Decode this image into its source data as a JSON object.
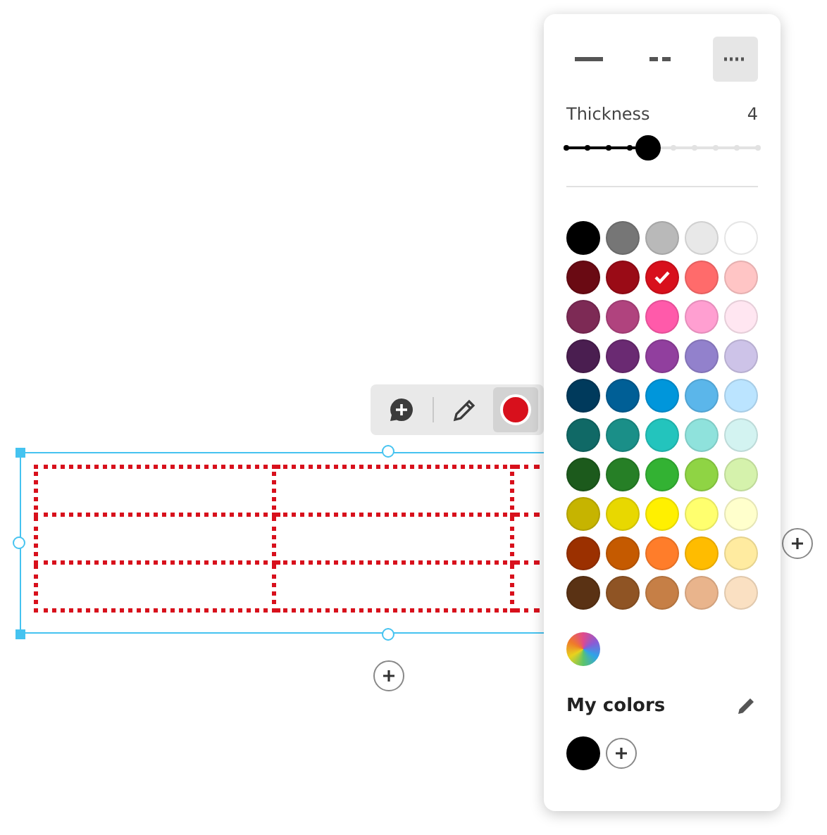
{
  "canvas": {
    "toolbar": [
      {
        "kind": "comment"
      },
      {
        "kind": "pen"
      },
      {
        "kind": "color",
        "selected": true
      }
    ]
  },
  "panel": {
    "line_styles": [
      {
        "kind": "solid",
        "selected": false
      },
      {
        "kind": "dashed",
        "selected": false
      },
      {
        "kind": "dotted",
        "selected": true
      }
    ],
    "thickness": {
      "label": "Thickness",
      "value": "4",
      "level": 0.43
    },
    "swatches": [
      {
        "color": "#000000",
        "selected": false
      },
      {
        "color": "#767676",
        "selected": false
      },
      {
        "color": "#b9b9b9",
        "selected": false
      },
      {
        "color": "#e8e8e8",
        "selected": false
      },
      {
        "color": "#ffffff",
        "selected": false
      },
      {
        "color": "#6a0a13",
        "selected": false
      },
      {
        "color": "#9a0b16",
        "selected": false
      },
      {
        "color": "#d8101c",
        "selected": true
      },
      {
        "color": "#ff6b6b",
        "selected": false
      },
      {
        "color": "#ffc5c5",
        "selected": false
      },
      {
        "color": "#7d2a55",
        "selected": false
      },
      {
        "color": "#b0437e",
        "selected": false
      },
      {
        "color": "#ff5aaa",
        "selected": false
      },
      {
        "color": "#ff9fd1",
        "selected": false
      },
      {
        "color": "#ffe6f1",
        "selected": false
      },
      {
        "color": "#4a1e50",
        "selected": false
      },
      {
        "color": "#6a2a72",
        "selected": false
      },
      {
        "color": "#913f9e",
        "selected": false
      },
      {
        "color": "#9281cc",
        "selected": false
      },
      {
        "color": "#cdc3e8",
        "selected": false
      },
      {
        "color": "#003a5c",
        "selected": false
      },
      {
        "color": "#005f96",
        "selected": false
      },
      {
        "color": "#0096db",
        "selected": false
      },
      {
        "color": "#5bb6ea",
        "selected": false
      },
      {
        "color": "#bbe4ff",
        "selected": false
      },
      {
        "color": "#106966",
        "selected": false
      },
      {
        "color": "#1a8f88",
        "selected": false
      },
      {
        "color": "#23c4bd",
        "selected": false
      },
      {
        "color": "#8fe2dc",
        "selected": false
      },
      {
        "color": "#d3f3f1",
        "selected": false
      },
      {
        "color": "#1c5a1c",
        "selected": false
      },
      {
        "color": "#267f26",
        "selected": false
      },
      {
        "color": "#33b233",
        "selected": false
      },
      {
        "color": "#8fd444",
        "selected": false
      },
      {
        "color": "#d5f2ac",
        "selected": false
      },
      {
        "color": "#c6b400",
        "selected": false
      },
      {
        "color": "#e8d800",
        "selected": false
      },
      {
        "color": "#fff000",
        "selected": false
      },
      {
        "color": "#ffff6e",
        "selected": false
      },
      {
        "color": "#ffffcc",
        "selected": false
      },
      {
        "color": "#9b3000",
        "selected": false
      },
      {
        "color": "#c55a00",
        "selected": false
      },
      {
        "color": "#ff7d2a",
        "selected": false
      },
      {
        "color": "#ffbc00",
        "selected": false
      },
      {
        "color": "#ffeba0",
        "selected": false
      },
      {
        "color": "#5a3214",
        "selected": false
      },
      {
        "color": "#8f5424",
        "selected": false
      },
      {
        "color": "#c67f46",
        "selected": false
      },
      {
        "color": "#e9b48c",
        "selected": false
      },
      {
        "color": "#fae0c2",
        "selected": false
      }
    ],
    "my_colors_title": "My colors",
    "my_colors": [
      {
        "color": "#000000"
      }
    ]
  }
}
